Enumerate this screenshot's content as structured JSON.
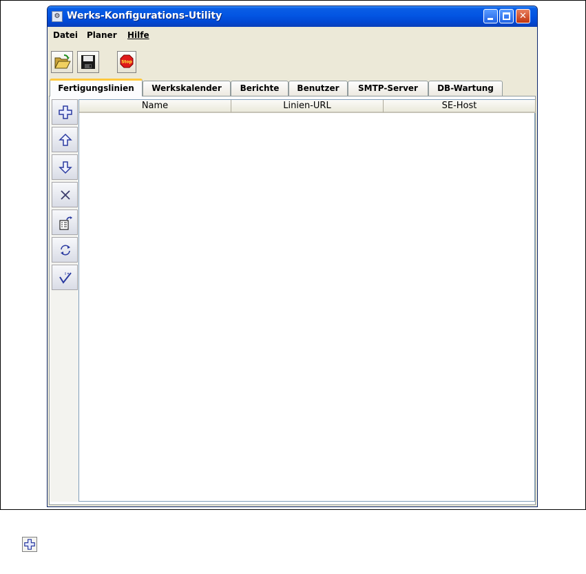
{
  "window": {
    "title": "Werks-Konfigurations-Utility",
    "app_icon": "app-icon",
    "controls": [
      "minimize-icon",
      "maximize-icon",
      "close-icon"
    ]
  },
  "menubar": {
    "items": [
      {
        "label": "Datei"
      },
      {
        "label": "Planer"
      },
      {
        "label": "Hilfe"
      }
    ]
  },
  "toolbar": {
    "buttons": [
      {
        "icon": "open-folder-icon"
      },
      {
        "icon": "save-disk-icon"
      },
      {
        "icon": "stop-sign-icon",
        "text": "Stop"
      }
    ]
  },
  "tabs": [
    {
      "label": "Fertigungslinien",
      "active": true
    },
    {
      "label": "Werkskalender"
    },
    {
      "label": "Berichte"
    },
    {
      "label": "Benutzer"
    },
    {
      "label": "SMTP-Server"
    },
    {
      "label": "DB-Wartung"
    }
  ],
  "side_toolbar": {
    "buttons": [
      {
        "icon": "add-plus-icon"
      },
      {
        "icon": "move-up-arrow-icon"
      },
      {
        "icon": "move-down-arrow-icon"
      },
      {
        "icon": "delete-x-icon"
      },
      {
        "icon": "edit-properties-icon"
      },
      {
        "icon": "refresh-icon"
      },
      {
        "icon": "validate-check-icon"
      }
    ]
  },
  "table": {
    "columns": [
      "Name",
      "Linien-URL",
      "SE-Host"
    ],
    "rows": []
  },
  "footer": {
    "icon": "add-plus-icon"
  },
  "colors": {
    "titlebar": "#0355e2",
    "active_tab_accent": "#ffc83c",
    "window_background": "#ece9d8"
  }
}
